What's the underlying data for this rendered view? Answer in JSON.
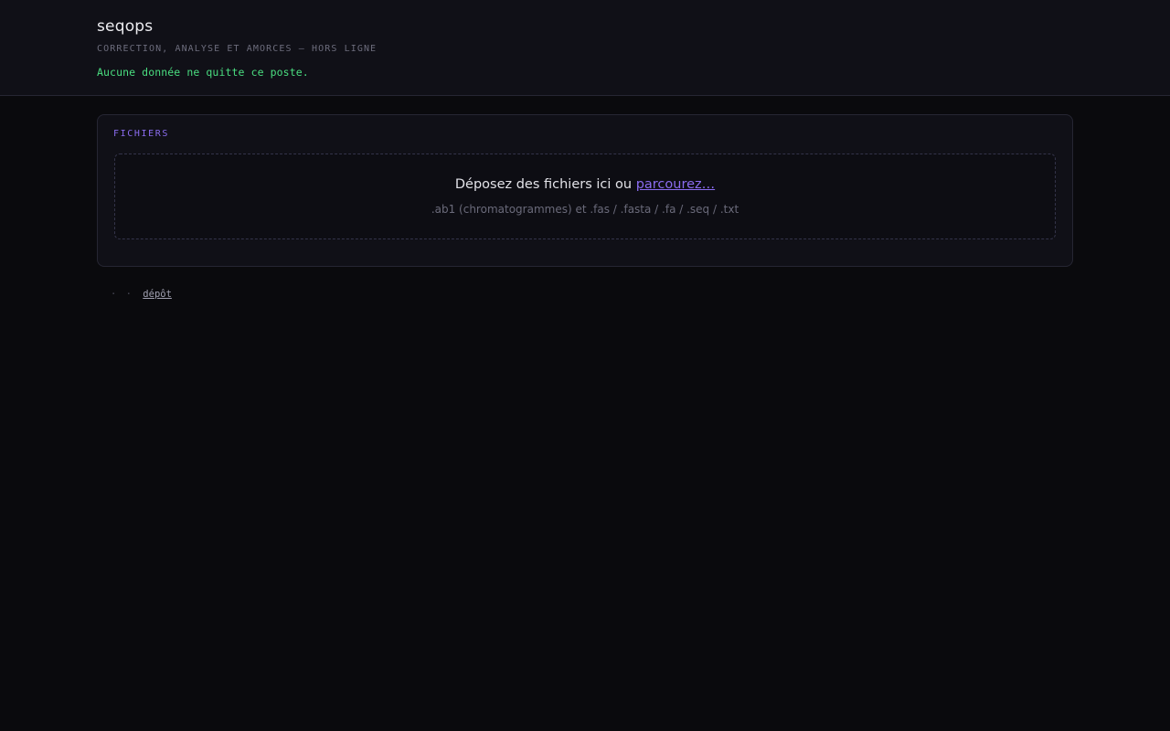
{
  "header": {
    "title": "seqops",
    "subtitle": "Correction, analyse et amorces — hors ligne",
    "privacy_note": "Aucune donnée ne quitte ce poste."
  },
  "files_panel": {
    "title": "Fichiers",
    "dropzone": {
      "prompt": "Déposez des fichiers ici ou ",
      "browse_label": "parcourez…",
      "hint": ".ab1 (chromatogrammes) et .fas / .fasta / .fa / .seq / .txt"
    }
  },
  "breadcrumb": {
    "separator": "· ·",
    "current": "dépôt"
  },
  "colors": {
    "background": "#0a0a0d",
    "panel": "#101017",
    "accent": "#8b6cf0",
    "success": "#4ade80",
    "muted": "#6c6c7c"
  }
}
